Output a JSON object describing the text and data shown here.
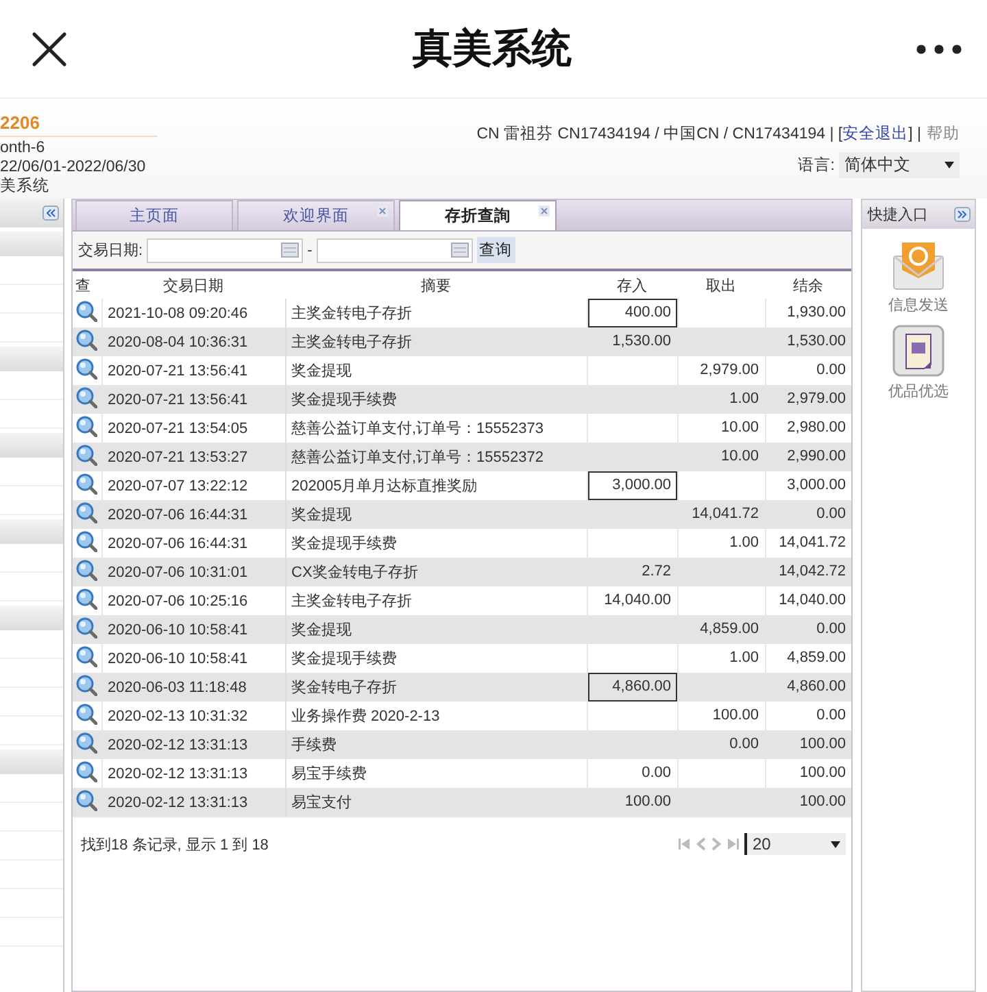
{
  "app_bar": {
    "title": "真美系统"
  },
  "header": {
    "code": "2206",
    "period_label": "onth-6",
    "date_range": "22/06/01-2022/06/30",
    "system_name": "美系统",
    "account_text": "CN 雷祖芬 CN17434194 / 中国CN / CN17434194 | [",
    "logout_link": "安全退出",
    "account_tail": "] |",
    "help_link": "帮助",
    "language_label": "语言:",
    "language_value": "简体中文"
  },
  "tabs": [
    {
      "label": "主页面",
      "selected": false,
      "closable": false
    },
    {
      "label": "欢迎界面",
      "selected": false,
      "closable": true
    },
    {
      "label": "存折查詢",
      "selected": true,
      "closable": true
    }
  ],
  "filter": {
    "label": "交易日期:",
    "separator": "-",
    "search_button": "查询"
  },
  "table": {
    "columns": [
      "查",
      "交易日期",
      "摘要",
      "存入",
      "取出",
      "结余"
    ],
    "rows": [
      {
        "date": "2021-10-08 09:20:46",
        "summary": "主奖金转电子存折",
        "deposit": "400.00",
        "withdrawal": "",
        "balance": "1,930.00",
        "boxed": true
      },
      {
        "date": "2020-08-04 10:36:31",
        "summary": "主奖金转电子存折",
        "deposit": "1,530.00",
        "withdrawal": "",
        "balance": "1,530.00",
        "boxed": false
      },
      {
        "date": "2020-07-21 13:56:41",
        "summary": "奖金提现",
        "deposit": "",
        "withdrawal": "2,979.00",
        "balance": "0.00",
        "boxed": false
      },
      {
        "date": "2020-07-21 13:56:41",
        "summary": "奖金提现手续费",
        "deposit": "",
        "withdrawal": "1.00",
        "balance": "2,979.00",
        "boxed": false
      },
      {
        "date": "2020-07-21 13:54:05",
        "summary": "慈善公益订单支付,订单号：15552373",
        "deposit": "",
        "withdrawal": "10.00",
        "balance": "2,980.00",
        "boxed": false
      },
      {
        "date": "2020-07-21 13:53:27",
        "summary": "慈善公益订单支付,订单号：15552372",
        "deposit": "",
        "withdrawal": "10.00",
        "balance": "2,990.00",
        "boxed": false
      },
      {
        "date": "2020-07-07 13:22:12",
        "summary": "202005月单月达标直推奖励",
        "deposit": "3,000.00",
        "withdrawal": "",
        "balance": "3,000.00",
        "boxed": true
      },
      {
        "date": "2020-07-06 16:44:31",
        "summary": "奖金提现",
        "deposit": "",
        "withdrawal": "14,041.72",
        "balance": "0.00",
        "boxed": false
      },
      {
        "date": "2020-07-06 16:44:31",
        "summary": "奖金提现手续费",
        "deposit": "",
        "withdrawal": "1.00",
        "balance": "14,041.72",
        "boxed": false
      },
      {
        "date": "2020-07-06 10:31:01",
        "summary": "CX奖金转电子存折",
        "deposit": "2.72",
        "withdrawal": "",
        "balance": "14,042.72",
        "boxed": false
      },
      {
        "date": "2020-07-06 10:25:16",
        "summary": "主奖金转电子存折",
        "deposit": "14,040.00",
        "withdrawal": "",
        "balance": "14,040.00",
        "boxed": false
      },
      {
        "date": "2020-06-10 10:58:41",
        "summary": "奖金提现",
        "deposit": "",
        "withdrawal": "4,859.00",
        "balance": "0.00",
        "boxed": false
      },
      {
        "date": "2020-06-10 10:58:41",
        "summary": "奖金提现手续费",
        "deposit": "",
        "withdrawal": "1.00",
        "balance": "4,859.00",
        "boxed": false
      },
      {
        "date": "2020-06-03 11:18:48",
        "summary": "奖金转电子存折",
        "deposit": "4,860.00",
        "withdrawal": "",
        "balance": "4,860.00",
        "boxed": true
      },
      {
        "date": "2020-02-13 10:31:32",
        "summary": "业务操作费 2020-2-13",
        "deposit": "",
        "withdrawal": "100.00",
        "balance": "0.00",
        "boxed": false
      },
      {
        "date": "2020-02-12 13:31:13",
        "summary": "手续费",
        "deposit": "",
        "withdrawal": "0.00",
        "balance": "100.00",
        "boxed": false
      },
      {
        "date": "2020-02-12 13:31:13",
        "summary": "易宝手续费",
        "deposit": "0.00",
        "withdrawal": "",
        "balance": "100.00",
        "boxed": false
      },
      {
        "date": "2020-02-12 13:31:13",
        "summary": "易宝支付",
        "deposit": "100.00",
        "withdrawal": "",
        "balance": "100.00",
        "boxed": false
      }
    ]
  },
  "footer": {
    "record_info": "找到18 条记录, 显示 1 到 18",
    "page_size": "20"
  },
  "quick_panel": {
    "title": "快捷入口",
    "items": [
      {
        "label": "信息发送",
        "kind": "mail"
      },
      {
        "label": "优品优选",
        "kind": "document"
      }
    ]
  }
}
